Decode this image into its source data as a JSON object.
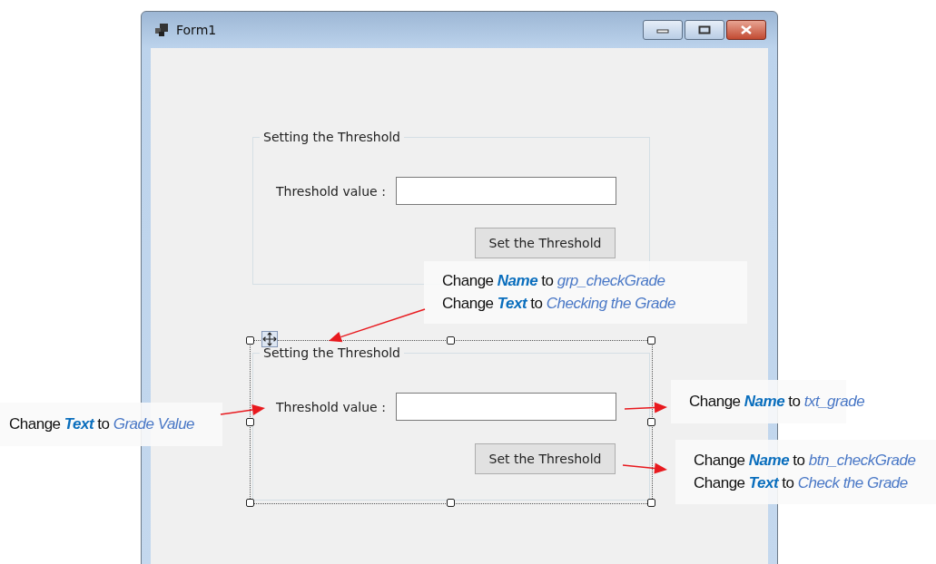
{
  "window": {
    "title": "Form1"
  },
  "group_boxes": [
    {
      "title": "Setting the Threshold",
      "label": "Threshold value :",
      "button": "Set the Threshold",
      "selected": false
    },
    {
      "title": "Setting the Threshold",
      "label": "Threshold value :",
      "button": "Set the Threshold",
      "selected": true
    }
  ],
  "callouts": [
    {
      "lines": [
        "Change **Name** to *grp_checkGrade*",
        "Change **Text** to *Checking the Grade*"
      ]
    },
    {
      "lines": [
        "Change **Text** to *Grade Value*"
      ]
    },
    {
      "lines": [
        "Change **Name** to *txt_grade*"
      ]
    },
    {
      "lines": [
        "Change **Name** to *btn_checkGrade*",
        "Change **Text** to *Check the Grade*"
      ]
    }
  ]
}
